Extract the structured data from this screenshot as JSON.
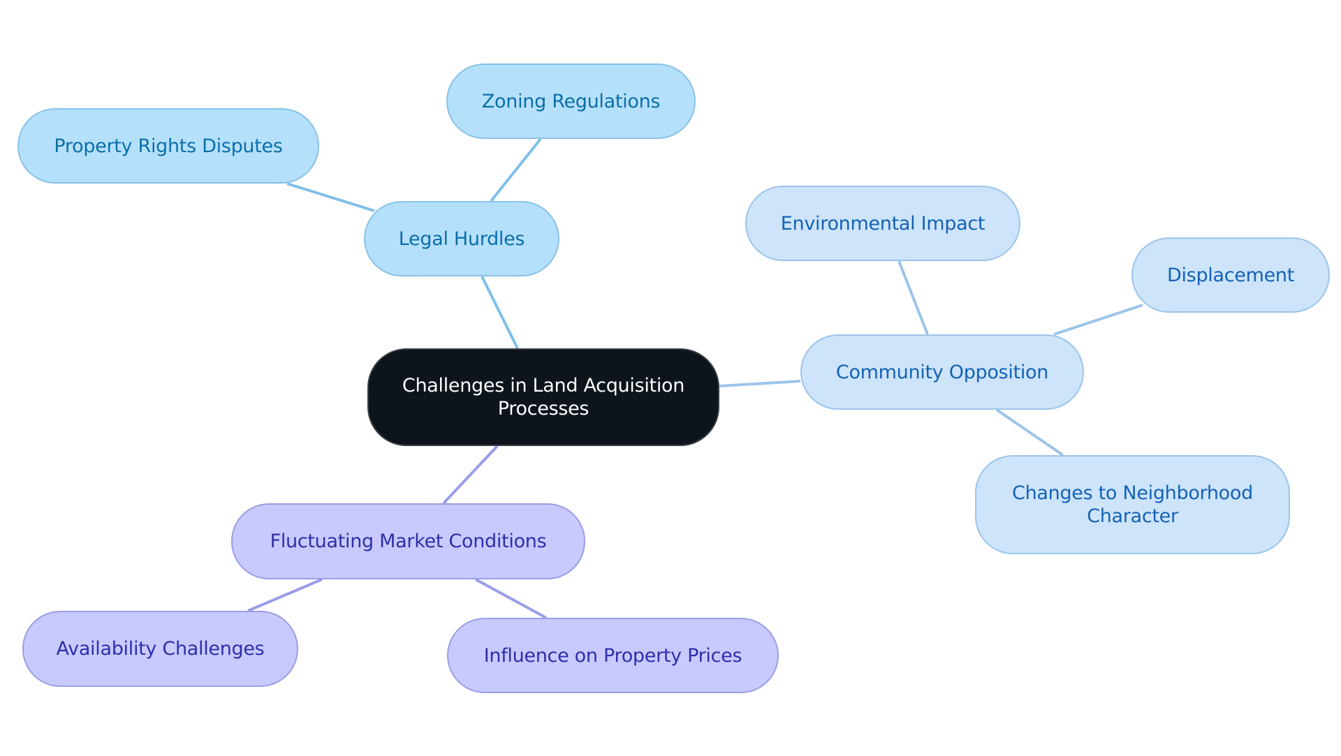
{
  "title": "Challenges in Land Acquisition Processes",
  "colors": {
    "root_fill": "#0d141c",
    "legal_branch": "#b5e0fc",
    "legal_edge": "#7fbfe8",
    "community_branch": "#cde4fb",
    "community_edge": "#9cc4ea",
    "market_branch": "#c8caff",
    "market_edge": "#9a9de6"
  },
  "root": {
    "label": "Challenges in Land Acquisition Processes"
  },
  "branches": [
    {
      "label": "Legal Hurdles",
      "children": [
        {
          "label": "Zoning Regulations"
        },
        {
          "label": "Property Rights Disputes"
        }
      ]
    },
    {
      "label": "Community Opposition",
      "children": [
        {
          "label": "Environmental Impact"
        },
        {
          "label": "Displacement"
        },
        {
          "label": "Changes to Neighborhood Character"
        }
      ]
    },
    {
      "label": "Fluctuating Market Conditions",
      "children": [
        {
          "label": "Availability Challenges"
        },
        {
          "label": "Influence on Property Prices"
        }
      ]
    }
  ]
}
